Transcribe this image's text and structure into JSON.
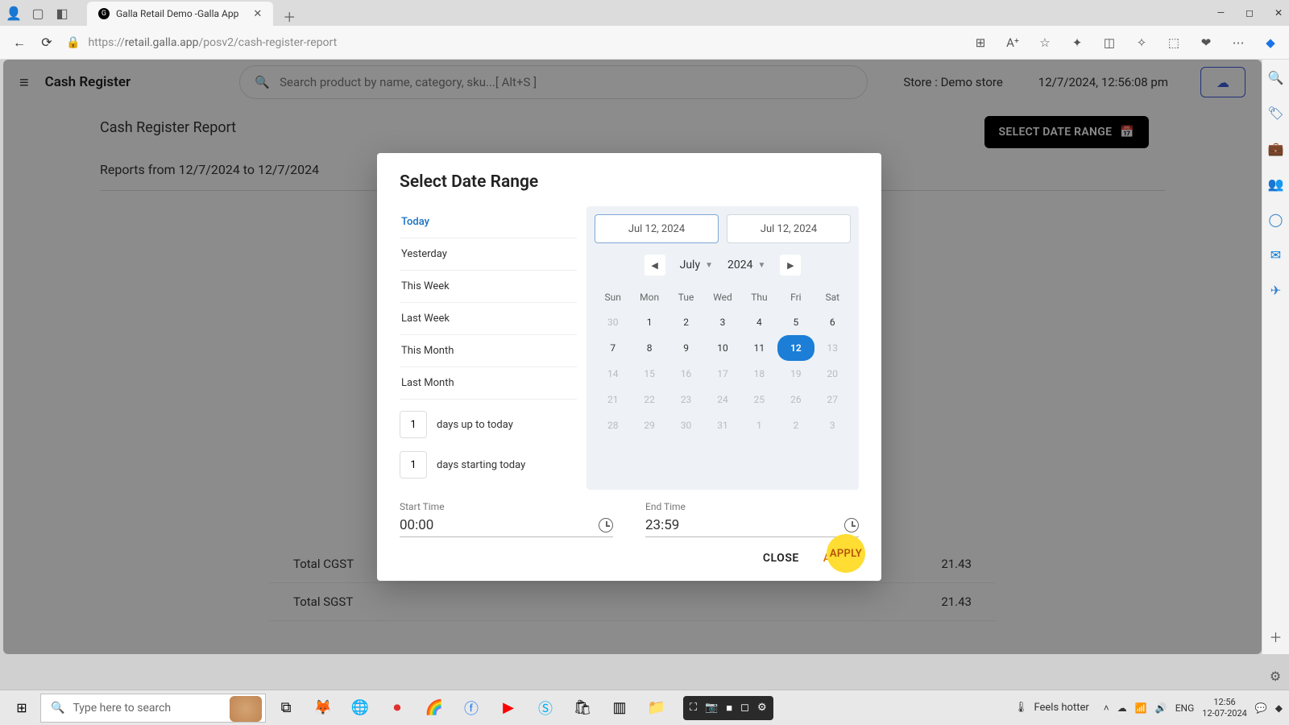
{
  "browser": {
    "tab_title": "Galla Retail Demo -Galla App",
    "url_prefix": "https://",
    "url_host": "retail.galla.app",
    "url_path": "/posv2/cash-register-report"
  },
  "header": {
    "app_title": "Cash Register",
    "search_placeholder": "Search product by name, category, sku...[ Alt+S ]",
    "store_label": "Store : Demo store",
    "datetime": "12/7/2024, 12:56:08 pm"
  },
  "page": {
    "title": "Cash Register Report",
    "select_range_btn": "SELECT DATE RANGE",
    "reports_from": "Reports from 12/7/2024 to 12/7/2024",
    "rows": [
      {
        "label": "Total CGST",
        "value": "21.43"
      },
      {
        "label": "Total SGST",
        "value": "21.43"
      }
    ]
  },
  "modal": {
    "title": "Select Date Range",
    "presets": [
      "Today",
      "Yesterday",
      "This Week",
      "Last Week",
      "This Month",
      "Last Month"
    ],
    "days_up_label": "days up to today",
    "days_up_value": "1",
    "days_start_label": "days starting today",
    "days_start_value": "1",
    "date_from": "Jul 12, 2024",
    "date_to": "Jul 12, 2024",
    "month": "July",
    "year": "2024",
    "weekdays": [
      "Sun",
      "Mon",
      "Tue",
      "Wed",
      "Thu",
      "Fri",
      "Sat"
    ],
    "calendar": [
      [
        "30",
        "1",
        "2",
        "3",
        "4",
        "5",
        "6"
      ],
      [
        "7",
        "8",
        "9",
        "10",
        "11",
        "12",
        "13"
      ],
      [
        "14",
        "15",
        "16",
        "17",
        "18",
        "19",
        "20"
      ],
      [
        "21",
        "22",
        "23",
        "24",
        "25",
        "26",
        "27"
      ],
      [
        "28",
        "29",
        "30",
        "31",
        "1",
        "2",
        "3"
      ]
    ],
    "selected_day": "12",
    "start_time_label": "Start Time",
    "start_time": "00:00",
    "end_time_label": "End Time",
    "end_time": "23:59",
    "close_btn": "CLOSE",
    "apply_btn": "APPLY"
  },
  "taskbar": {
    "search_placeholder": "Type here to search",
    "weather": "Feels hotter",
    "lang": "ENG",
    "time": "12:56",
    "date": "12-07-2024"
  }
}
